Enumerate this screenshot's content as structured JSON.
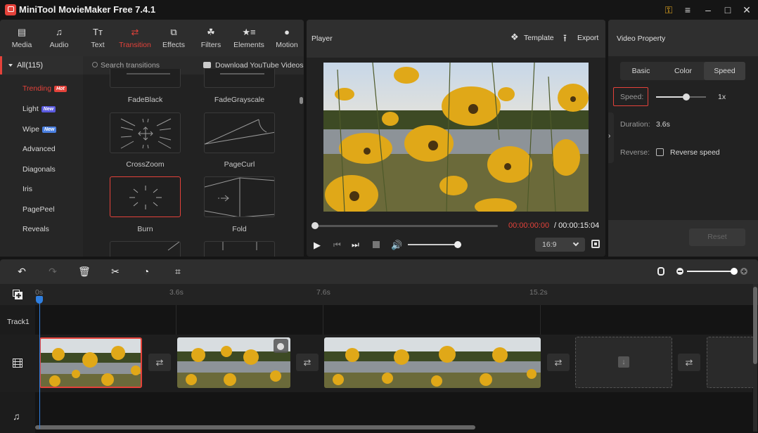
{
  "app": {
    "title": "MiniTool MovieMaker Free 7.4.1",
    "window_controls": [
      "key-icon",
      "menu-icon",
      "minimize-icon",
      "maximize-icon",
      "close-icon"
    ]
  },
  "media_toolbar": {
    "items": [
      {
        "label": "Media",
        "icon": "folder-icon"
      },
      {
        "label": "Audio",
        "icon": "music-note-icon"
      },
      {
        "label": "Text",
        "icon": "text-icon"
      },
      {
        "label": "Transition",
        "icon": "transition-arrows-icon",
        "active": true
      },
      {
        "label": "Effects",
        "icon": "effects-icon"
      },
      {
        "label": "Filters",
        "icon": "filters-icon"
      },
      {
        "label": "Elements",
        "icon": "elements-icon"
      },
      {
        "label": "Motion",
        "icon": "motion-icon"
      }
    ]
  },
  "categories": {
    "all_label": "All(115)",
    "items": [
      {
        "label": "Trending",
        "badge": "Hot",
        "badge_color": "#e4423a",
        "active": true
      },
      {
        "label": "Light",
        "badge": "New",
        "badge_color": "#5b5be0"
      },
      {
        "label": "Wipe",
        "badge": "New",
        "badge_color": "#4a7fe0"
      },
      {
        "label": "Advanced"
      },
      {
        "label": "Diagonals"
      },
      {
        "label": "Iris"
      },
      {
        "label": "PagePeel"
      },
      {
        "label": "Reveals"
      }
    ]
  },
  "transitions": {
    "search_placeholder": "Search transitions",
    "download_label": "Download YouTube Videos",
    "items": [
      {
        "label": "FadeBlack"
      },
      {
        "label": "FadeGrayscale"
      },
      {
        "label": "CrossZoom"
      },
      {
        "label": "PageCurl"
      },
      {
        "label": "Burn",
        "selected": true
      },
      {
        "label": "Fold"
      }
    ]
  },
  "player": {
    "title": "Player",
    "template_label": "Template",
    "export_label": "Export",
    "current_time": "00:00:00:00",
    "total_time": "/ 00:00:15:04",
    "progress": 0,
    "volume": 0.93,
    "aspect_ratio": "16:9"
  },
  "property": {
    "title": "Video Property",
    "tabs": [
      {
        "label": "Basic"
      },
      {
        "label": "Color"
      },
      {
        "label": "Speed",
        "active": true
      }
    ],
    "speed_label": "Speed:",
    "speed_value": "1x",
    "speed_slider": 0.6,
    "duration_label": "Duration:",
    "duration_value": "3.6s",
    "reverse_label": "Reverse:",
    "reverse_checkbox_label": "Reverse speed",
    "reverse_checked": false,
    "reset_label": "Reset"
  },
  "timeline": {
    "tools": [
      "undo-icon",
      "redo-icon",
      "delete-icon",
      "split-icon",
      "speed-icon",
      "crop-icon"
    ],
    "zoom_level": 1.0,
    "ruler_ticks": [
      "0s",
      "3.6s",
      "7.6s",
      "15.2s"
    ],
    "track_label": "Track1",
    "accent": "#2f7fe0"
  }
}
